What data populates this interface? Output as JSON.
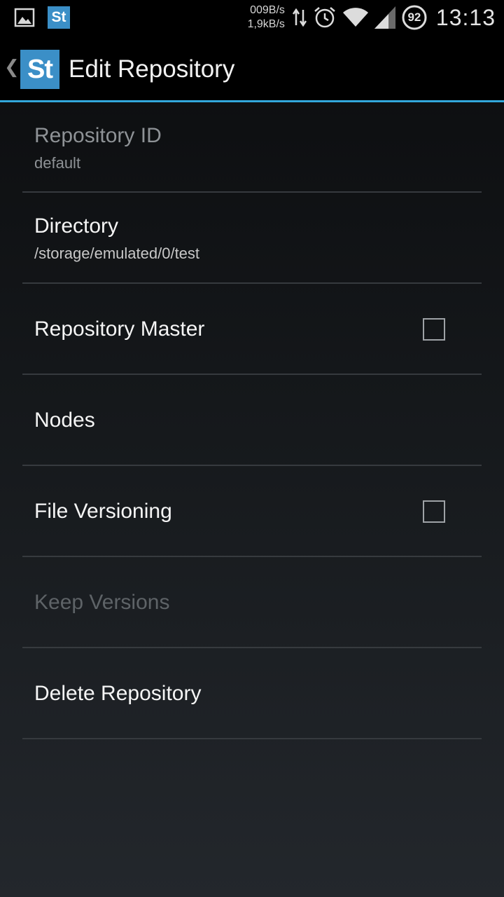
{
  "status_bar": {
    "upload_speed": "009B/s",
    "download_speed": "1,9kB/s",
    "battery": "92",
    "time": "13:13",
    "icons": [
      "gallery-icon",
      "syncthing-notification-icon",
      "data-transfer-icon",
      "alarm-icon",
      "wifi-icon",
      "cell-signal-icon",
      "battery-icon"
    ]
  },
  "action_bar": {
    "logo_text": "St",
    "title": "Edit Repository",
    "accent_color": "#33a7db"
  },
  "preferences": {
    "repository_id": {
      "title": "Repository ID",
      "summary": "default"
    },
    "directory": {
      "title": "Directory",
      "summary": "/storage/emulated/0/test"
    },
    "repository_master": {
      "title": "Repository Master",
      "checked": false
    },
    "nodes": {
      "title": "Nodes"
    },
    "file_versioning": {
      "title": "File Versioning",
      "checked": false
    },
    "keep_versions": {
      "title": "Keep Versions"
    },
    "delete_repository": {
      "title": "Delete Repository"
    }
  }
}
